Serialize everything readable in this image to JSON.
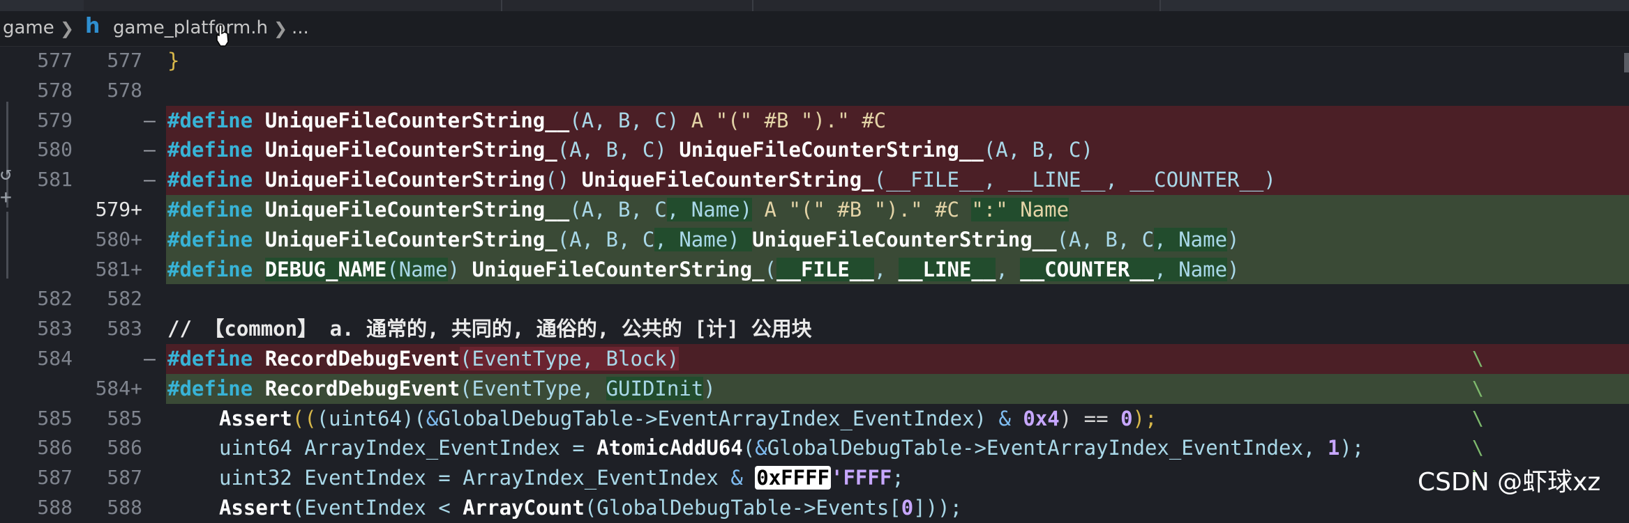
{
  "breadcrumb": {
    "folder": "game",
    "file_icon": "h",
    "file": "game_platform.h",
    "more": "..."
  },
  "lines": [
    {
      "old": "577",
      "new": "577",
      "mark": "",
      "type": "ctx"
    },
    {
      "old": "578",
      "new": "578",
      "mark": "",
      "type": "ctx"
    },
    {
      "old": "579",
      "new": "",
      "mark": "—",
      "type": "del"
    },
    {
      "old": "580",
      "new": "",
      "mark": "—",
      "type": "del"
    },
    {
      "old": "581",
      "new": "",
      "mark": "—",
      "type": "del"
    },
    {
      "old": "",
      "new": "579+",
      "mark": "",
      "type": "add"
    },
    {
      "old": "",
      "new": "580+",
      "mark": "",
      "type": "add"
    },
    {
      "old": "",
      "new": "581+",
      "mark": "",
      "type": "add"
    },
    {
      "old": "582",
      "new": "582",
      "mark": "",
      "type": "ctx"
    },
    {
      "old": "583",
      "new": "583",
      "mark": "",
      "type": "ctx"
    },
    {
      "old": "584",
      "new": "",
      "mark": "—",
      "type": "del"
    },
    {
      "old": "",
      "new": "584+",
      "mark": "",
      "type": "add"
    },
    {
      "old": "585",
      "new": "585",
      "mark": "",
      "type": "ctx"
    },
    {
      "old": "586",
      "new": "586",
      "mark": "",
      "type": "ctx"
    },
    {
      "old": "587",
      "new": "587",
      "mark": "",
      "type": "ctx"
    },
    {
      "old": "588",
      "new": "588",
      "mark": "",
      "type": "ctx"
    }
  ],
  "code": {
    "brace": "}",
    "define": "#define",
    "ufcs2": "UniqueFileCounterString__",
    "ufcs1": "UniqueFileCounterString_",
    "ufcs0": "UniqueFileCounterString",
    "debug_name": "DEBUG_NAME",
    "l579_args": "(A, B, C)",
    "l579_body": " A \"(\" #B \").\" #C",
    "l580_args": "(A, B, C) ",
    "l580_call_args": "(A, B, C)",
    "l581_args": "() ",
    "l581_call_args": "(__FILE__, __LINE__, __COUNTER__)",
    "n579_args_a": "(A, B, C",
    "n579_args_b": ", Name)",
    "n579_body_a": " A \"(\" #B \").\" #C ",
    "n579_body_b": "\":\" Name",
    "n580_args_a": "(A, B, C",
    "n580_args_b": ", Name) ",
    "n580_call_a": "(A, B, C",
    "n580_call_b": ", Name",
    "n580_call_c": ")",
    "n581_param_open": "(",
    "n581_param": "Name",
    "n581_param_close": ") ",
    "n581_call_open": "(",
    "n581_file": "__FILE__",
    "n581_c1": ", ",
    "n581_line": "__LINE__",
    "n581_c2": ", ",
    "n581_counter": "__COUNTER__",
    "n581_name": ", Name",
    "n581_close": ")",
    "comment": "// 【common】 a. 通常的, 共同的, 通俗的, 公共的 [计] 公用块",
    "rde": "RecordDebugEvent",
    "l584_args": "(EventType, Block)",
    "n584_args_a": "(EventType, ",
    "n584_args_b": "GUIDInit",
    "n584_args_c": ")",
    "l585_assert": "Assert",
    "l585_a": "((",
    "l585_b": "(uint64)",
    "l585_c": "(",
    "l585_amp": "&",
    "l585_d": "GlobalDebugTable->EventArrayIndex_EventIndex",
    "l585_e": ") ",
    "l585_amp2": "&",
    "l585_num": " 0x4",
    "l585_f": ") == ",
    "l585_zero": "0",
    "l585_g": ");",
    "l586_a": "uint64 ArrayIndex_EventIndex = ",
    "l586_fn": "AtomicAddU64",
    "l586_b": "(",
    "l586_amp": "&",
    "l586_c": "GlobalDebugTable->EventArrayIndex_EventIndex, ",
    "l586_one": "1",
    "l586_d": ");",
    "l587_a": "uint32 EventIndex = ArrayIndex_EventIndex ",
    "l587_amp": "&",
    "l587_sp": " ",
    "l587_hex": "0xFFFF",
    "l587_hex2": "'FFFF",
    "l587_end": ";",
    "l588_assert": "Assert",
    "l588_a": "(EventIndex < ",
    "l588_fn": "ArrayCount",
    "l588_b": "(GlobalDebugTable->Events[",
    "l588_zero": "0",
    "l588_c": "]));",
    "backslash": "\\"
  },
  "watermark": "CSDN @虾球xz",
  "colors": {
    "deleted_bg": "#4b1f26",
    "added_bg": "#3a4a36",
    "keyword": "#38b3d6",
    "editor_bg": "#1e2026"
  }
}
